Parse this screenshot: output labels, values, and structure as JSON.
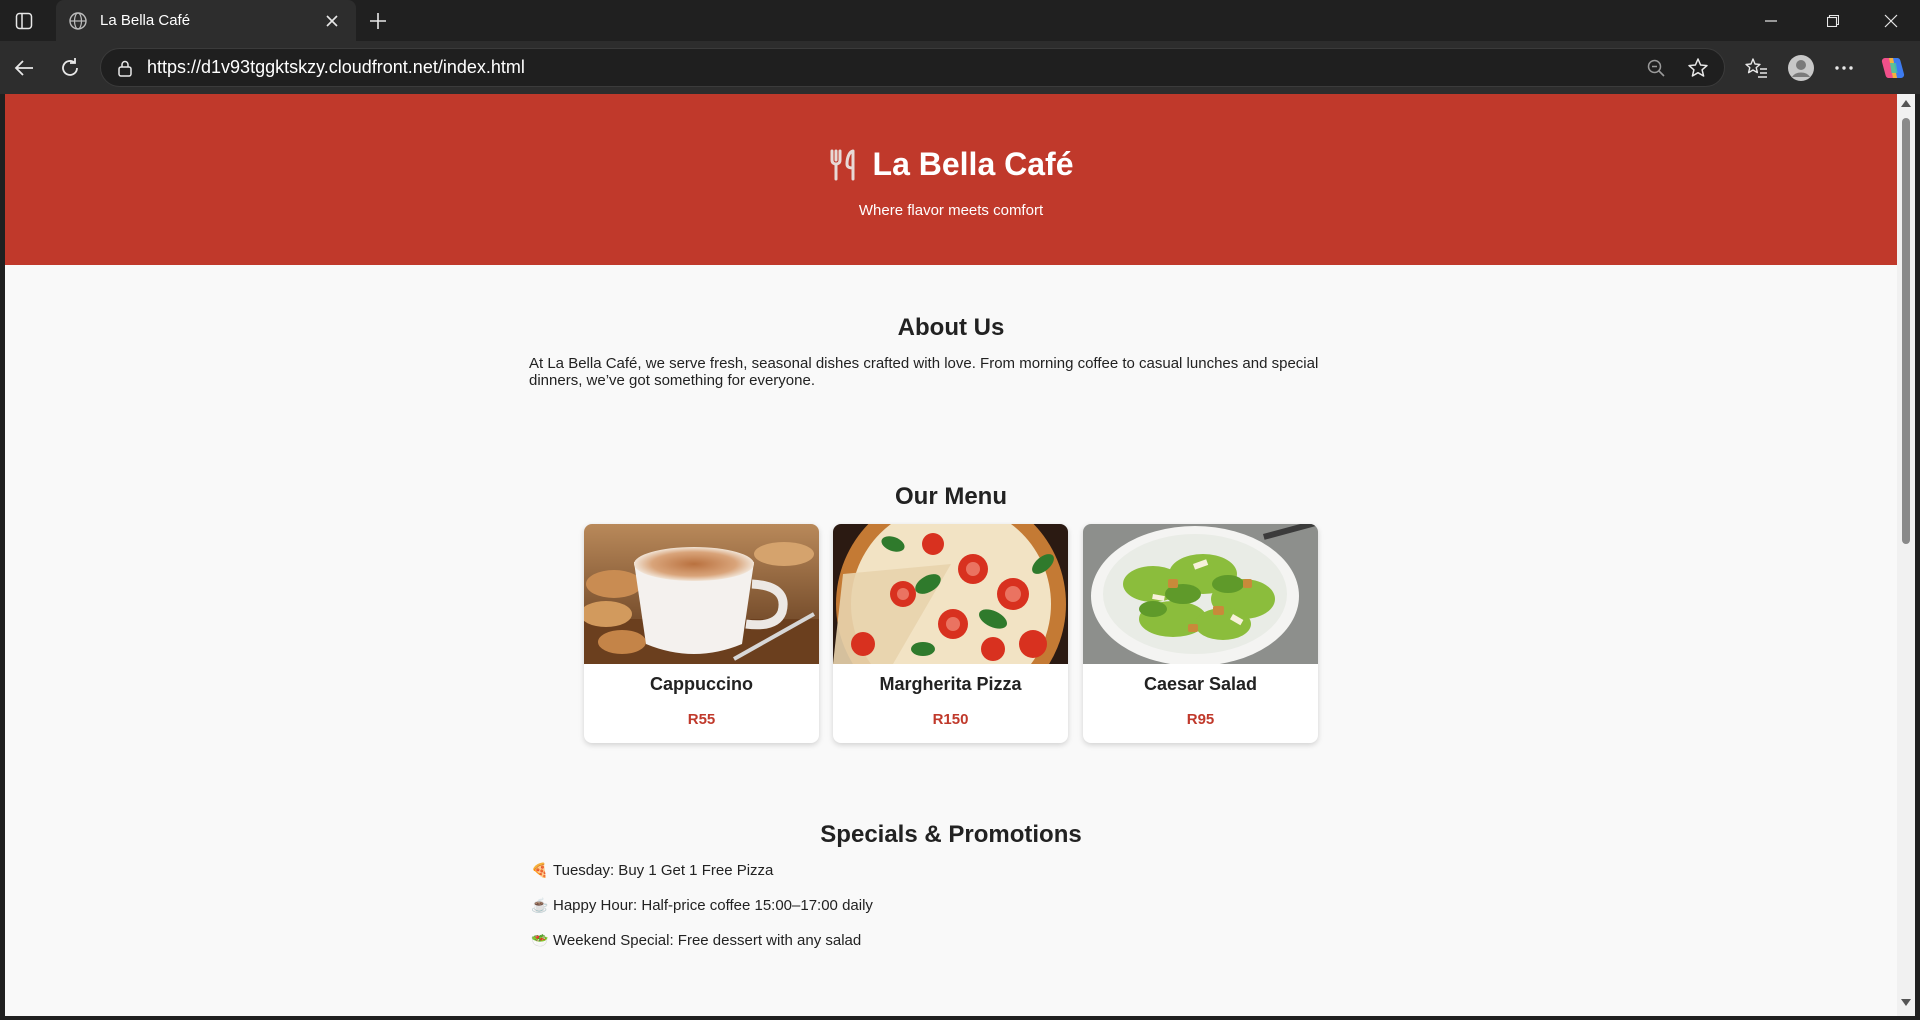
{
  "browser": {
    "tab_title": "La Bella Café",
    "url": "https://d1v93tggktskzy.cloudfront.net/index.html"
  },
  "hero": {
    "title": "La Bella Café",
    "tagline": "Where flavor meets comfort",
    "icon": "fork-knife-icon"
  },
  "about": {
    "heading": "About Us",
    "text": "At La Bella Café, we serve fresh, seasonal dishes crafted with love. From morning coffee to casual lunches and special dinners, we’ve got something for everyone."
  },
  "menu": {
    "heading": "Our Menu",
    "items": [
      {
        "name": "Cappuccino",
        "price": "R55"
      },
      {
        "name": "Margherita Pizza",
        "price": "R150"
      },
      {
        "name": "Caesar Salad",
        "price": "R95"
      }
    ]
  },
  "specials": {
    "heading": "Specials & Promotions",
    "items": [
      {
        "emoji": "🍕",
        "text": "Tuesday: Buy 1 Get 1 Free Pizza"
      },
      {
        "emoji": "☕",
        "text": "Happy Hour: Half-price coffee 15:00–17:00 daily"
      },
      {
        "emoji": "🥗",
        "text": "Weekend Special: Free dessert with any salad"
      }
    ]
  },
  "colors": {
    "accent": "#c0392b",
    "page_bg": "#f9f9f9",
    "chrome_bg": "#2d2d2d"
  }
}
